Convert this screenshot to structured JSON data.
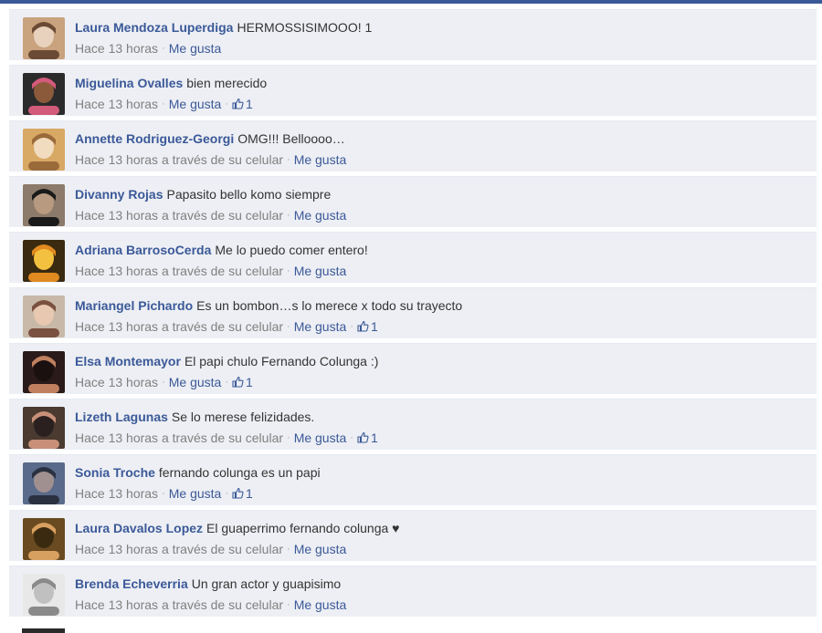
{
  "like_label": "Me gusta",
  "comments": [
    {
      "name": "Laura Mendoza Luperdiga",
      "text": "HERMOSSISIMOOO! 1",
      "time": "Hace 13 horas",
      "likes": "",
      "avatar_colors": [
        "#c9a27e",
        "#6b4a35",
        "#e8d2bd"
      ]
    },
    {
      "name": "Miguelina Ovalles",
      "text": "bien merecido",
      "time": "Hace 13 horas",
      "likes": "1",
      "avatar_colors": [
        "#2b2b2b",
        "#d25a7a",
        "#8b5a3b"
      ]
    },
    {
      "name": "Annette Rodriguez-Georgi",
      "text": "OMG!!! Belloooo…",
      "time": "Hace 13 horas a través de su celular",
      "likes": "",
      "avatar_colors": [
        "#d8a865",
        "#9a6a3a",
        "#f2dcc0"
      ]
    },
    {
      "name": "Divanny Rojas",
      "text": "Papasito bello komo siempre",
      "time": "Hace 13 horas a través de su celular",
      "likes": "",
      "avatar_colors": [
        "#8c7a6a",
        "#1a1a1a",
        "#b89a80"
      ]
    },
    {
      "name": "Adriana BarrosoCerda",
      "text": "Me lo puedo comer entero!",
      "time": "Hace 13 horas a través de su celular",
      "likes": "",
      "avatar_colors": [
        "#3a2a10",
        "#e08a20",
        "#f4c040"
      ]
    },
    {
      "name": "Mariangel Pichardo",
      "text": "Es un bombon…s lo merece x todo su trayecto",
      "time": "Hace 13 horas a través de su celular",
      "likes": "1",
      "avatar_colors": [
        "#c8b8a8",
        "#7a5040",
        "#e8c8b0"
      ]
    },
    {
      "name": "Elsa Montemayor",
      "text": "El papi chulo Fernando Colunga :)",
      "time": "Hace 13 horas",
      "likes": "1",
      "avatar_colors": [
        "#2a1a1a",
        "#c08060",
        "#1a1010"
      ]
    },
    {
      "name": "Lizeth Lagunas",
      "text": "Se lo merese felizidades.",
      "time": "Hace 13 horas a través de su celular",
      "likes": "1",
      "avatar_colors": [
        "#4a3a30",
        "#c89078",
        "#2a2020"
      ]
    },
    {
      "name": "Sonia Troche",
      "text": "fernando colunga es un papi",
      "time": "Hace 13 horas",
      "likes": "1",
      "avatar_colors": [
        "#5a6a8a",
        "#2a3040",
        "#a09090"
      ]
    },
    {
      "name": "Laura Davalos Lopez",
      "text": "El guaperrimo fernando colunga ♥",
      "time": "Hace 13 horas a través de su celular",
      "likes": "",
      "avatar_colors": [
        "#6a4a20",
        "#d8a060",
        "#3a2a10"
      ]
    },
    {
      "name": "Brenda Echeverria",
      "text": "Un gran actor y guapisimo",
      "time": "Hace 13 horas a través de su celular",
      "likes": "",
      "avatar_colors": [
        "#e8e8e8",
        "#8a8a8a",
        "#c0c0c0"
      ]
    }
  ],
  "colors": {
    "link_blue": "#3b5998",
    "row_background": "#edeff4",
    "meta_gray": "#808080",
    "text": "#333333"
  },
  "icons": {
    "thumb": "thumbs-up-icon"
  }
}
